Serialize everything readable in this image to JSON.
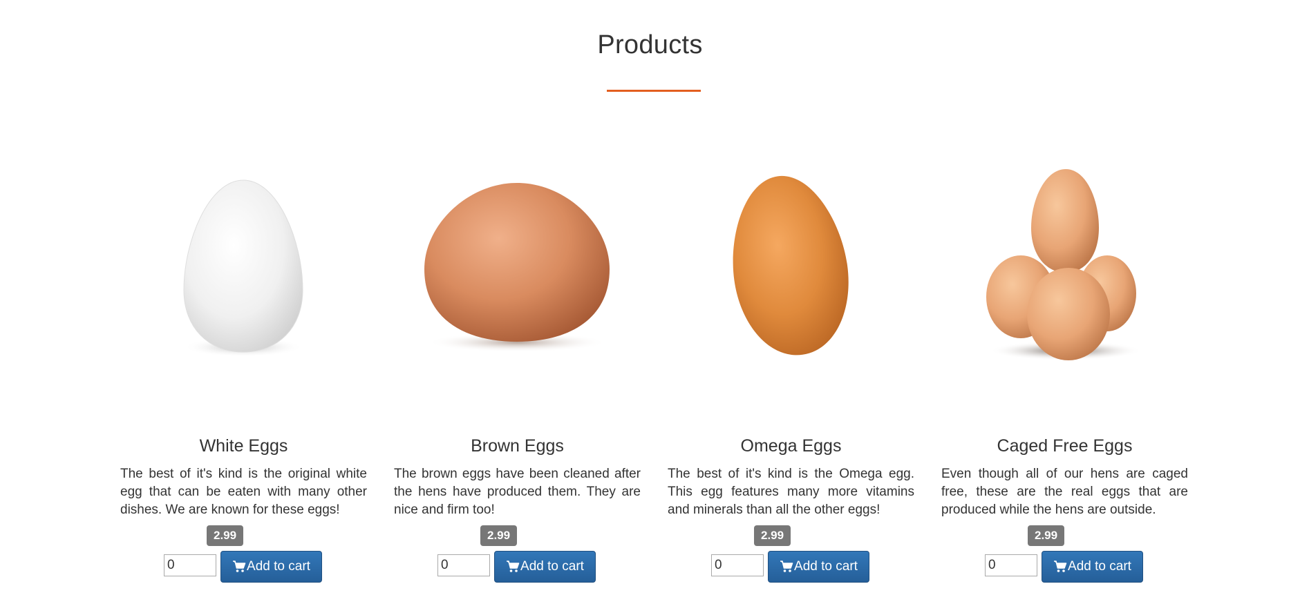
{
  "section": {
    "title": "Products",
    "accent_color": "#e35e1f"
  },
  "products": [
    {
      "name": "White Eggs",
      "description": "The best of it's kind is the original white egg that can be eaten with many other dishes. We are known for these eggs!",
      "price": "2.99",
      "quantity": "0",
      "button_label": "Add to cart",
      "image_icon": "white-egg-image"
    },
    {
      "name": "Brown Eggs",
      "description": "The brown eggs have been cleaned after the hens have produced them. They are nice and firm too!",
      "price": "2.99",
      "quantity": "0",
      "button_label": "Add to cart",
      "image_icon": "brown-egg-image"
    },
    {
      "name": "Omega Eggs",
      "description": "The best of it's kind is the Omega egg. This egg features many more vitamins and minerals than all the other eggs!",
      "price": "2.99",
      "quantity": "0",
      "button_label": "Add to cart",
      "image_icon": "omega-egg-image"
    },
    {
      "name": "Caged Free Eggs",
      "description": "Even though all of our hens are caged free, these are the real eggs that are produced while the hens are outside.",
      "price": "2.99",
      "quantity": "0",
      "button_label": "Add to cart",
      "image_icon": "caged-free-eggs-image"
    }
  ],
  "colors": {
    "button_primary": "#2a6aa9",
    "price_badge": "#777777",
    "text": "#333333"
  }
}
